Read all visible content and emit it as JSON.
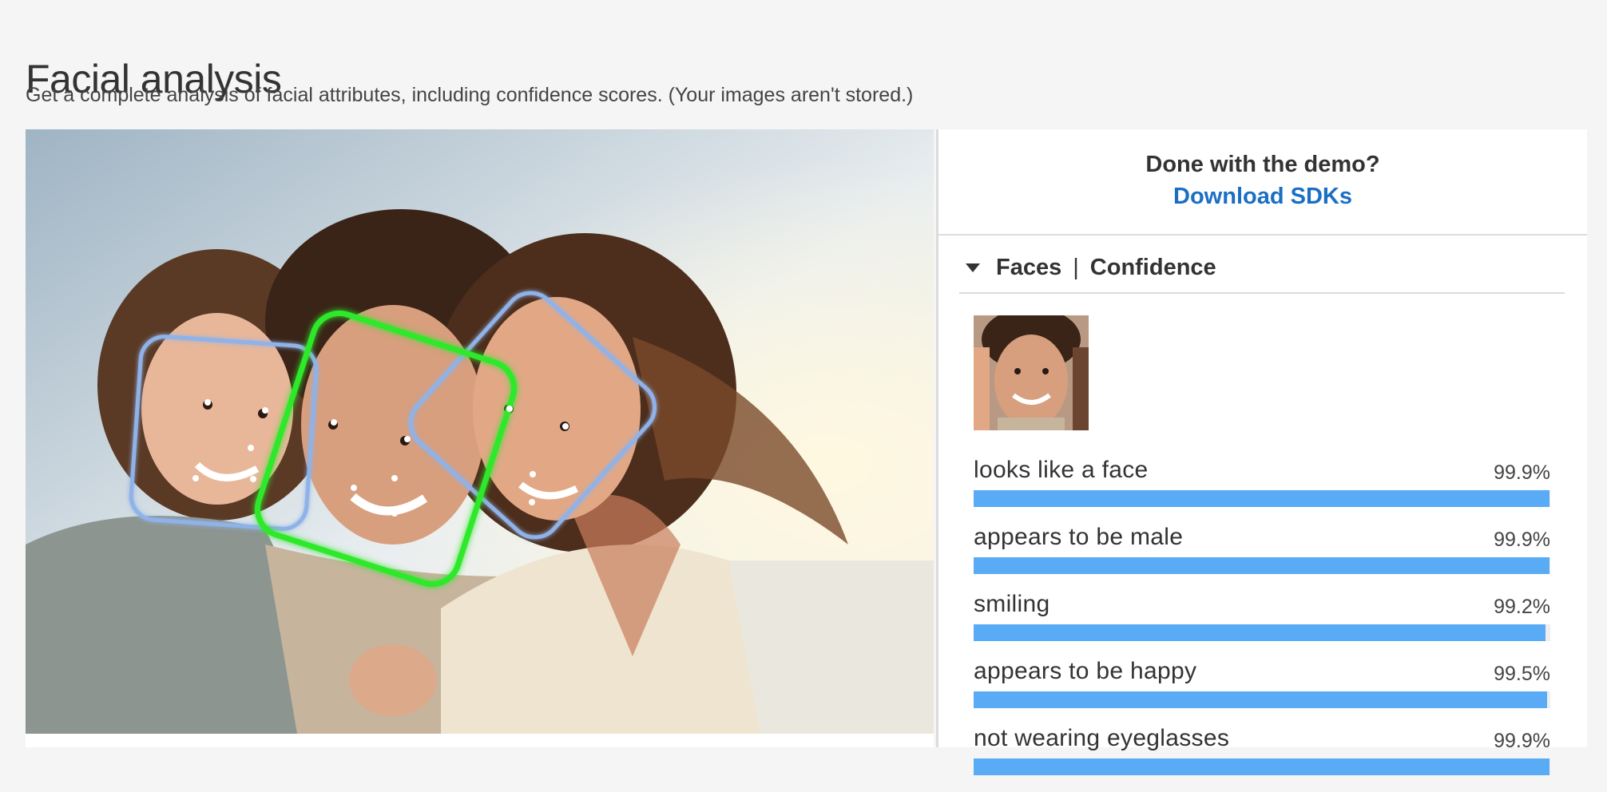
{
  "page": {
    "title": "Facial analysis",
    "subtitle": "Get a complete analysis of facial attributes, including confidence scores. (Your images aren't stored.)"
  },
  "demo": {
    "question": "Done with the demo?",
    "download_label": "Download SDKs"
  },
  "faces_panel": {
    "header_faces": "Faces",
    "header_separator": "|",
    "header_confidence": "Confidence",
    "attributes": [
      {
        "label": "looks like a face",
        "value": "99.9%",
        "confidence": 99.9
      },
      {
        "label": "appears to be male",
        "value": "99.9%",
        "confidence": 99.9
      },
      {
        "label": "smiling",
        "value": "99.2%",
        "confidence": 99.2
      },
      {
        "label": "appears to be happy",
        "value": "99.5%",
        "confidence": 99.5
      },
      {
        "label": "not wearing eyeglasses",
        "value": "99.9%",
        "confidence": 99.9
      }
    ]
  },
  "colors": {
    "accent_link": "#1a6fc3",
    "bar_fill": "#5aabf5",
    "selected_face_box": "#2ee82a",
    "other_face_box": "#8fb2e8"
  },
  "icons": {
    "caret": "caret-down-icon"
  }
}
